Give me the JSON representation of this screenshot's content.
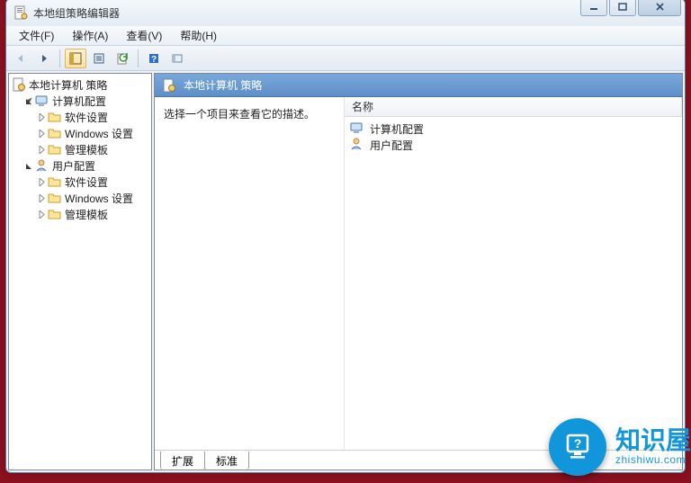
{
  "window": {
    "title": "本地组策略编辑器"
  },
  "menu": {
    "file": "文件(F)",
    "action": "操作(A)",
    "view": "查看(V)",
    "help": "帮助(H)"
  },
  "tree": {
    "root": "本地计算机 策略",
    "computer": {
      "label": "计算机配置",
      "children": {
        "software": "软件设置",
        "windows": "Windows 设置",
        "admin": "管理模板"
      }
    },
    "user": {
      "label": "用户配置",
      "children": {
        "software": "软件设置",
        "windows": "Windows 设置",
        "admin": "管理模板"
      }
    }
  },
  "right": {
    "header": "本地计算机 策略",
    "description": "选择一个项目来查看它的描述。",
    "column": "名称",
    "items": {
      "computer": "计算机配置",
      "user": "用户配置"
    }
  },
  "tabs": {
    "extended": "扩展",
    "standard": "标准"
  },
  "watermark": {
    "cn": "知识屋",
    "en": "zhishiwu.com"
  }
}
